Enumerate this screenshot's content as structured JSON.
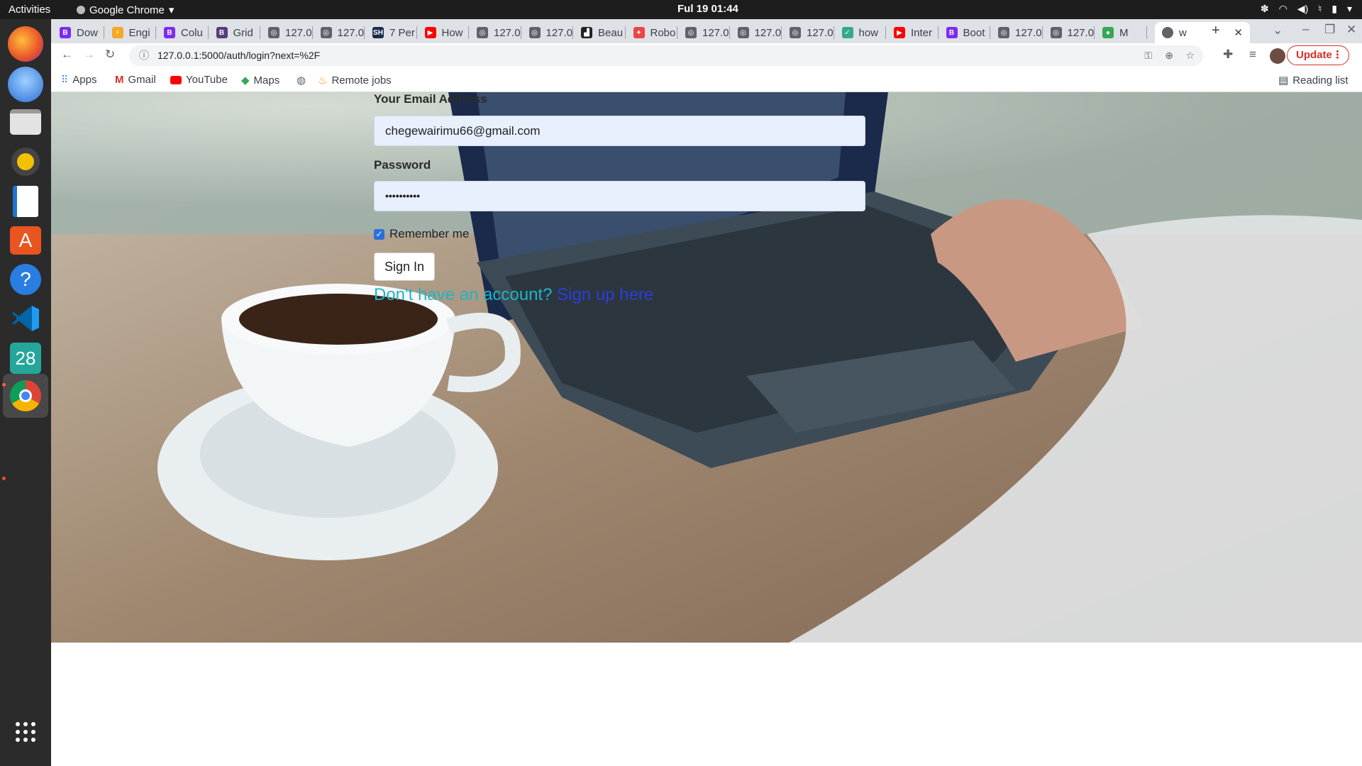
{
  "os": {
    "activities": "Activities",
    "app_name": "Google Chrome",
    "clock": "Ful 19  01:44",
    "dock": [
      "firefox-icon",
      "thunderbird-icon",
      "files-icon",
      "rhythmbox-icon",
      "writer-icon",
      "software-icon",
      "help-icon",
      "vscode-icon",
      "calendar-icon",
      "chrome-icon",
      "apps-grid-icon"
    ],
    "calendar_day": "28"
  },
  "tabs": [
    {
      "label": "Dow",
      "icon": "B",
      "color": "#7b2cf0"
    },
    {
      "label": "Engi",
      "icon": "⚡",
      "color": "#f6a623"
    },
    {
      "label": "Colu",
      "icon": "B",
      "color": "#7b2cf0"
    },
    {
      "label": "Grid",
      "icon": "B",
      "color": "#563d7c"
    },
    {
      "label": "127.0",
      "icon": "◎",
      "color": "#5f6368"
    },
    {
      "label": "127.0",
      "icon": "◎",
      "color": "#5f6368"
    },
    {
      "label": "7 Per",
      "icon": "SH",
      "color": "#1a2b4c"
    },
    {
      "label": "How",
      "icon": "▶",
      "color": "#ff0000"
    },
    {
      "label": "127.0",
      "icon": "◎",
      "color": "#5f6368"
    },
    {
      "label": "127.0",
      "icon": "◎",
      "color": "#5f6368"
    },
    {
      "label": "Beau",
      "icon": "▟",
      "color": "#222"
    },
    {
      "label": "Robo",
      "icon": "✦",
      "color": "#e44"
    },
    {
      "label": "127.0",
      "icon": "◎",
      "color": "#5f6368"
    },
    {
      "label": "127.0",
      "icon": "◎",
      "color": "#5f6368"
    },
    {
      "label": "127.0",
      "icon": "◎",
      "color": "#5f6368"
    },
    {
      "label": "how",
      "icon": "✓",
      "color": "#3a8"
    },
    {
      "label": "Inter",
      "icon": "▶",
      "color": "#ff0000"
    },
    {
      "label": "Boot",
      "icon": "B",
      "color": "#7b2cf0"
    },
    {
      "label": "127.0",
      "icon": "◎",
      "color": "#5f6368"
    },
    {
      "label": "127.0",
      "icon": "◎",
      "color": "#5f6368"
    },
    {
      "label": "M",
      "icon": "●",
      "color": "#34a853"
    }
  ],
  "active_tab": {
    "label": "w"
  },
  "toolbar": {
    "url": "127.0.0.1:5000/auth/login?next=%2F",
    "update_label": "Update"
  },
  "bookmarks": [
    {
      "label": "Apps",
      "icon": "apps-grid-icon"
    },
    {
      "label": "Gmail",
      "icon": "gmail-icon"
    },
    {
      "label": "YouTube",
      "icon": "youtube-icon"
    },
    {
      "label": "Maps",
      "icon": "maps-icon"
    },
    {
      "label": "",
      "icon": "globe-icon"
    },
    {
      "label": "Remote jobs",
      "icon": "remote-jobs-icon"
    }
  ],
  "reading_list": "Reading list",
  "form": {
    "email_label": "Your Email Address",
    "email_value": "chegewairimu66@gmail.com",
    "password_label": "Password",
    "password_value": "••••••••••",
    "remember_label": "Remember me",
    "remember_checked": true,
    "submit_label": "Sign In",
    "signup_prompt": "Don't have an account?",
    "signup_link": "Sign up here"
  }
}
